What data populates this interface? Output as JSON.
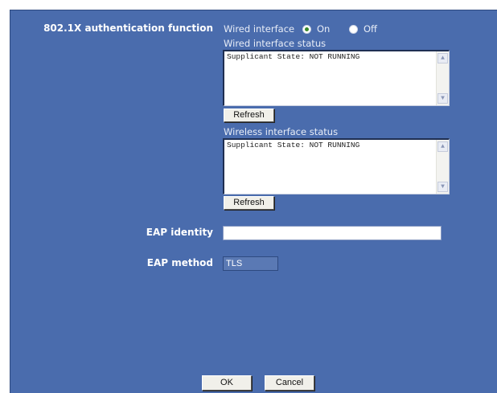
{
  "auth": {
    "label": "802.1X authentication function",
    "wired_interface_label": "Wired interface",
    "on_label": "On",
    "off_label": "Off",
    "selected": "On"
  },
  "wired_status": {
    "label": "Wired interface status",
    "content": "Supplicant State: NOT RUNNING",
    "refresh_label": "Refresh"
  },
  "wireless_status": {
    "label": "Wireless interface status",
    "content": "Supplicant State: NOT RUNNING",
    "refresh_label": "Refresh"
  },
  "eap_identity": {
    "label": "EAP identity",
    "value": ""
  },
  "eap_method": {
    "label": "EAP method",
    "value": "TLS"
  },
  "footer": {
    "ok_label": "OK",
    "cancel_label": "Cancel"
  }
}
